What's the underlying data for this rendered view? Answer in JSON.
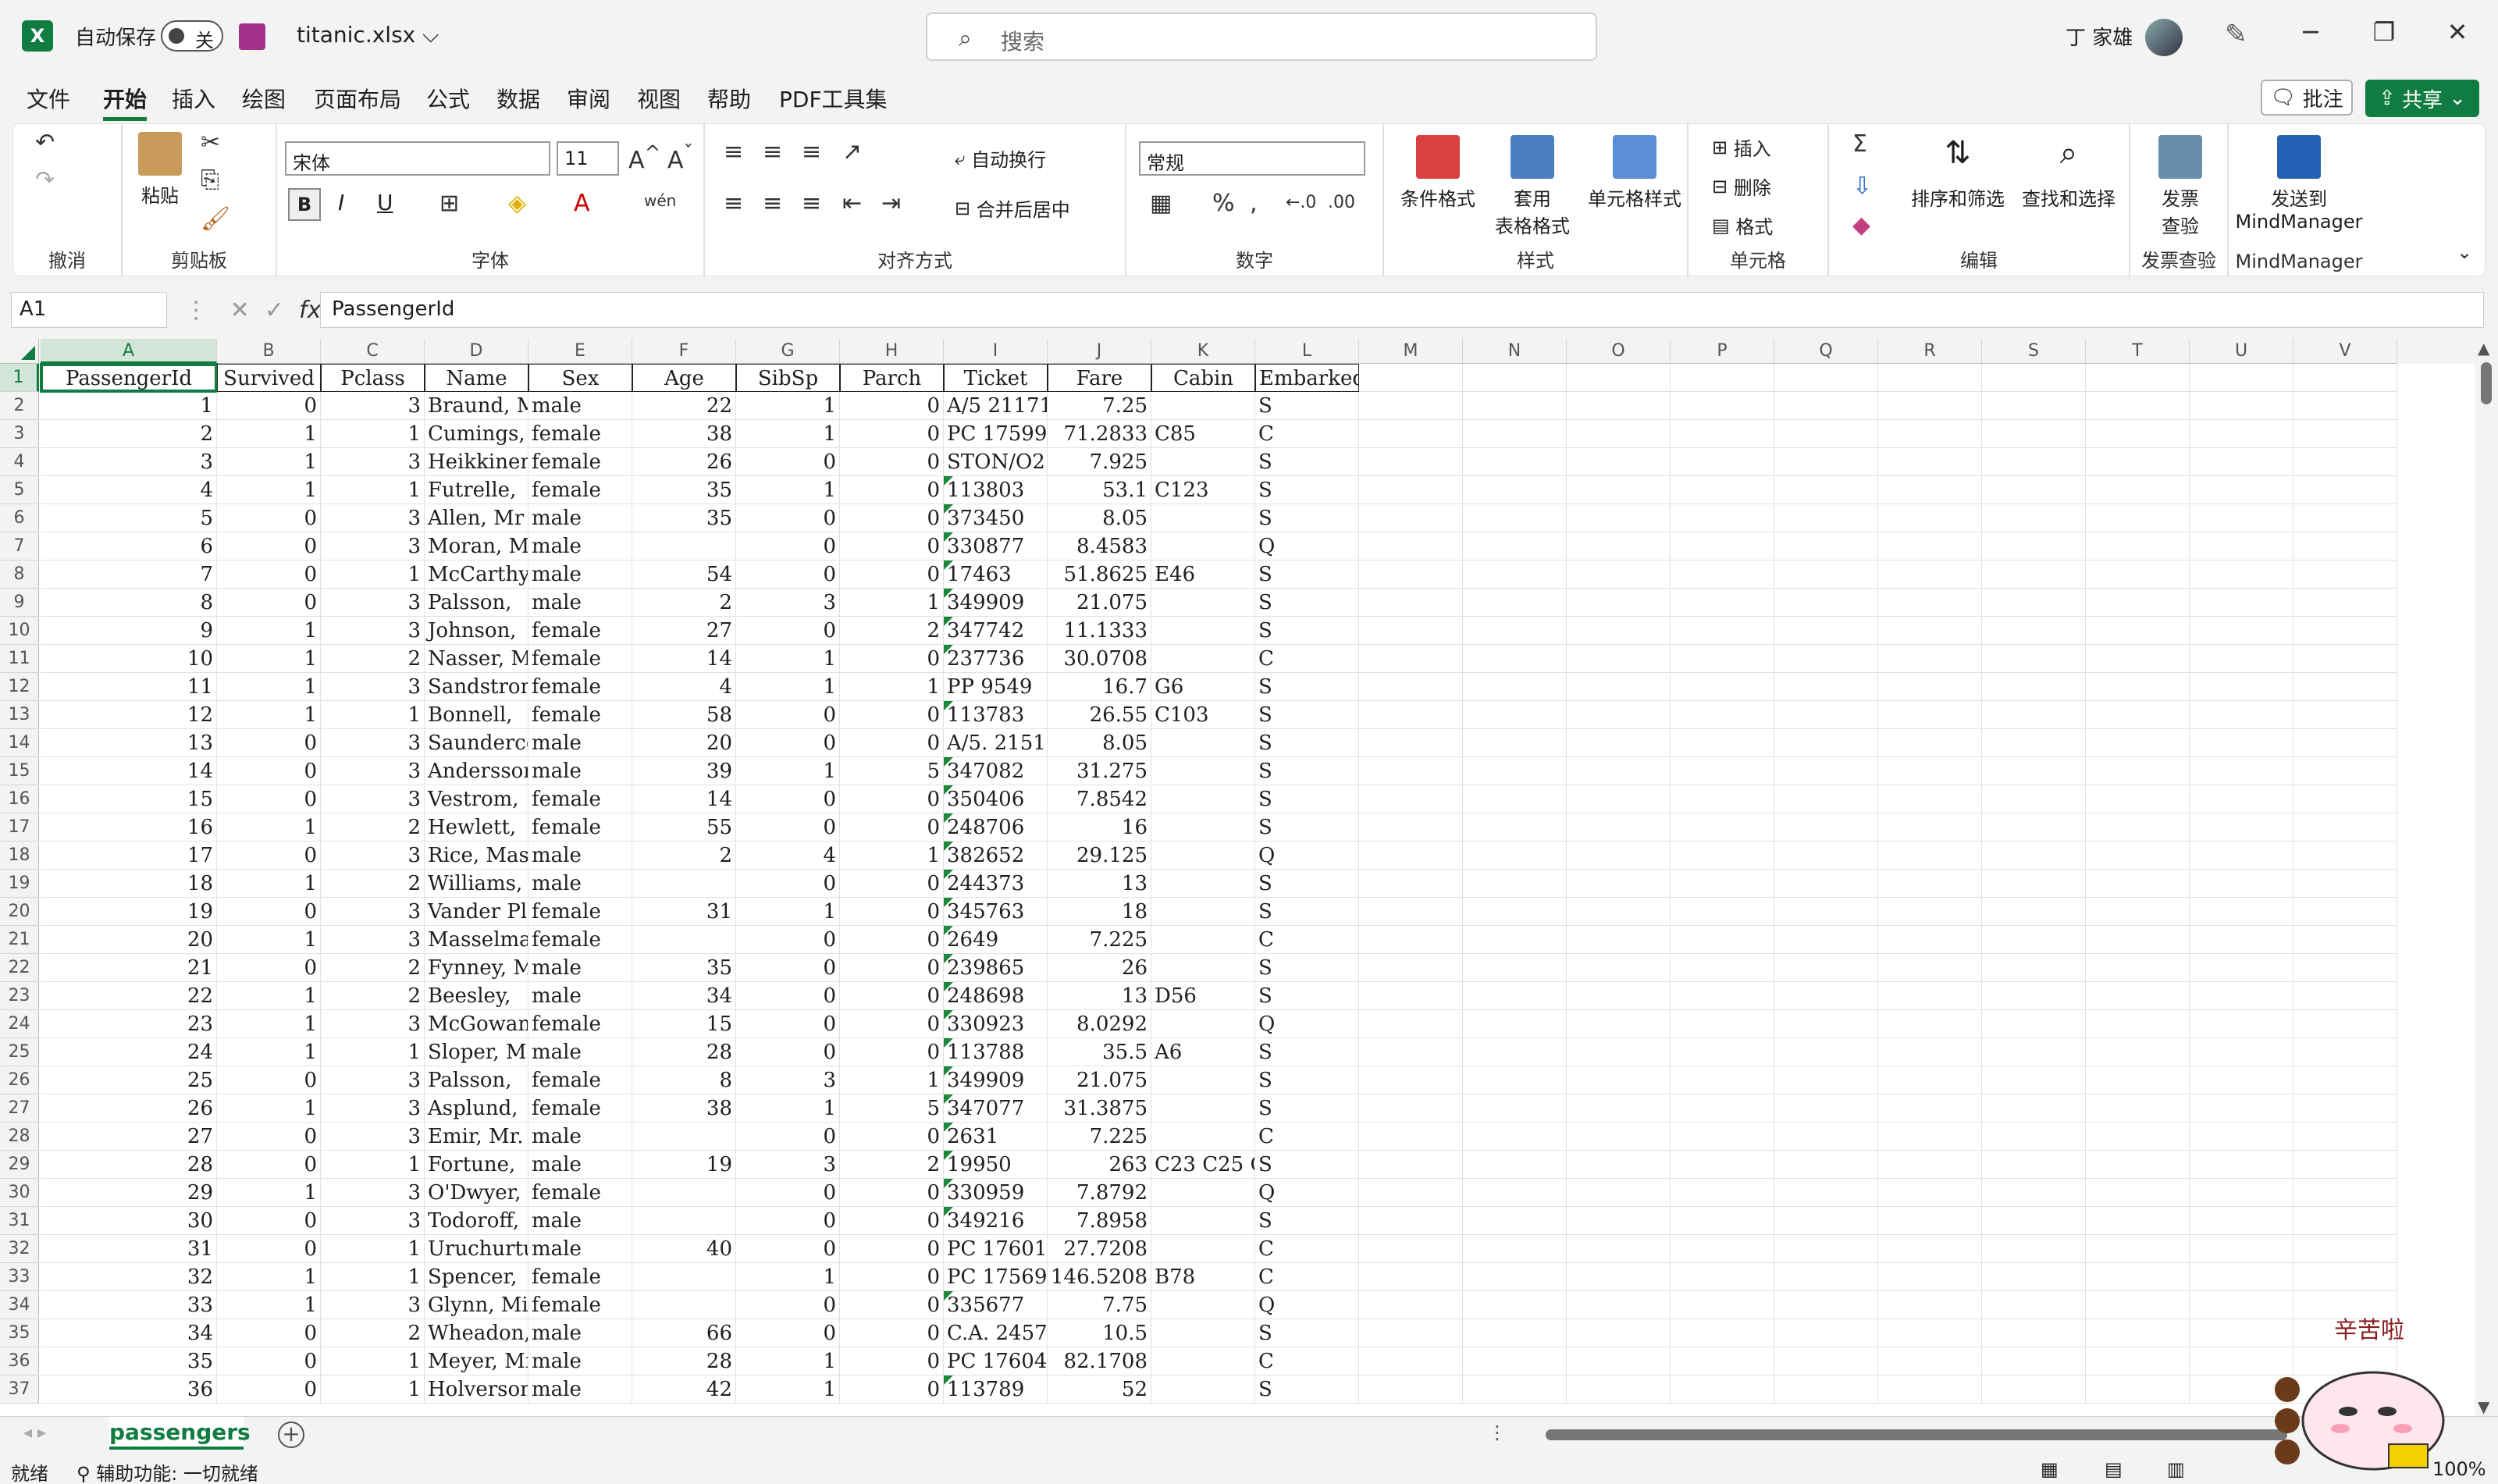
{
  "titlebar": {
    "autosave_label": "自动保存",
    "autosave_state": "关",
    "file_name": "titanic.xlsx ⌵",
    "search_placeholder": "搜索",
    "user_name": "丁 家雄",
    "minimize": "─",
    "restore": "❐",
    "close": "✕"
  },
  "menu": {
    "tabs": [
      "文件",
      "开始",
      "插入",
      "绘图",
      "页面布局",
      "公式",
      "数据",
      "审阅",
      "视图",
      "帮助",
      "PDF工具集"
    ],
    "active": "开始",
    "comment_label": "批注",
    "share_label": "共享"
  },
  "ribbon": {
    "undo_group": "撤消",
    "clipboard_group": "剪贴板",
    "paste_label": "粘贴",
    "font_group": "字体",
    "font_name": "宋体",
    "font_size": "11",
    "bold": "B",
    "italic": "I",
    "underline": "U",
    "align_group": "对齐方式",
    "wrap_label": "自动换行",
    "merge_label": "合并后居中",
    "number_group": "数字",
    "number_format": "常规",
    "styles_group": "样式",
    "cond_format": "条件格式",
    "table_format": "套用\n表格格式",
    "cell_styles": "单元格样式",
    "cells_group": "单元格",
    "insert_label": "插入",
    "delete_label": "删除",
    "format_label": "格式",
    "edit_group": "编辑",
    "sort_filter": "排序和筛选",
    "find_select": "查找和选择",
    "invoice_group": "发票查验",
    "invoice_label": "发票\n查验",
    "mindmanager_group": "MindManager",
    "mindmanager_label": "发送到\nMindManager"
  },
  "formula_bar": {
    "name_box": "A1",
    "formula": "PassengerId"
  },
  "columns": [
    "A",
    "B",
    "C",
    "D",
    "E",
    "F",
    "G",
    "H",
    "I",
    "J",
    "K",
    "L",
    "M",
    "N",
    "O",
    "P",
    "Q",
    "R",
    "S",
    "T",
    "U",
    "V"
  ],
  "header_row": [
    "PassengerId",
    "Survived",
    "Pclass",
    "Name",
    "Sex",
    "Age",
    "SibSp",
    "Parch",
    "Ticket",
    "Fare",
    "Cabin",
    "Embarked"
  ],
  "rows": [
    [
      "1",
      "0",
      "3",
      "Braund, M",
      "male",
      "22",
      "1",
      "0",
      "A/5 21171",
      "7.25",
      "",
      "S"
    ],
    [
      "2",
      "1",
      "1",
      "Cumings,",
      "female",
      "38",
      "1",
      "0",
      "PC 17599",
      "71.2833",
      "C85",
      "C"
    ],
    [
      "3",
      "1",
      "3",
      "Heikkinen",
      "female",
      "26",
      "0",
      "0",
      "STON/O2.",
      "7.925",
      "",
      "S"
    ],
    [
      "4",
      "1",
      "1",
      "Futrelle,",
      "female",
      "35",
      "1",
      "0",
      "113803",
      "53.1",
      "C123",
      "S"
    ],
    [
      "5",
      "0",
      "3",
      "Allen, Mr",
      "male",
      "35",
      "0",
      "0",
      "373450",
      "8.05",
      "",
      "S"
    ],
    [
      "6",
      "0",
      "3",
      "Moran, Mr",
      "male",
      "",
      "0",
      "0",
      "330877",
      "8.4583",
      "",
      "Q"
    ],
    [
      "7",
      "0",
      "1",
      "McCarthy,",
      "male",
      "54",
      "0",
      "0",
      "17463",
      "51.8625",
      "E46",
      "S"
    ],
    [
      "8",
      "0",
      "3",
      "Palsson,",
      "male",
      "2",
      "3",
      "1",
      "349909",
      "21.075",
      "",
      "S"
    ],
    [
      "9",
      "1",
      "3",
      "Johnson,",
      "female",
      "27",
      "0",
      "2",
      "347742",
      "11.1333",
      "",
      "S"
    ],
    [
      "10",
      "1",
      "2",
      "Nasser, M",
      "female",
      "14",
      "1",
      "0",
      "237736",
      "30.0708",
      "",
      "C"
    ],
    [
      "11",
      "1",
      "3",
      "Sandstrom",
      "female",
      "4",
      "1",
      "1",
      "PP 9549",
      "16.7",
      "G6",
      "S"
    ],
    [
      "12",
      "1",
      "1",
      "Bonnell,",
      "female",
      "58",
      "0",
      "0",
      "113783",
      "26.55",
      "C103",
      "S"
    ],
    [
      "13",
      "0",
      "3",
      "Saunderco",
      "male",
      "20",
      "0",
      "0",
      "A/5. 2151",
      "8.05",
      "",
      "S"
    ],
    [
      "14",
      "0",
      "3",
      "Andersson",
      "male",
      "39",
      "1",
      "5",
      "347082",
      "31.275",
      "",
      "S"
    ],
    [
      "15",
      "0",
      "3",
      "Vestrom,",
      "female",
      "14",
      "0",
      "0",
      "350406",
      "7.8542",
      "",
      "S"
    ],
    [
      "16",
      "1",
      "2",
      "Hewlett,",
      "female",
      "55",
      "0",
      "0",
      "248706",
      "16",
      "",
      "S"
    ],
    [
      "17",
      "0",
      "3",
      "Rice, Mas",
      "male",
      "2",
      "4",
      "1",
      "382652",
      "29.125",
      "",
      "Q"
    ],
    [
      "18",
      "1",
      "2",
      "Williams,",
      "male",
      "",
      "0",
      "0",
      "244373",
      "13",
      "",
      "S"
    ],
    [
      "19",
      "0",
      "3",
      "Vander Pl",
      "female",
      "31",
      "1",
      "0",
      "345763",
      "18",
      "",
      "S"
    ],
    [
      "20",
      "1",
      "3",
      "Masselmar",
      "female",
      "",
      "0",
      "0",
      "2649",
      "7.225",
      "",
      "C"
    ],
    [
      "21",
      "0",
      "2",
      "Fynney, M",
      "male",
      "35",
      "0",
      "0",
      "239865",
      "26",
      "",
      "S"
    ],
    [
      "22",
      "1",
      "2",
      "Beesley,",
      "male",
      "34",
      "0",
      "0",
      "248698",
      "13",
      "D56",
      "S"
    ],
    [
      "23",
      "1",
      "3",
      "McGowan,",
      "female",
      "15",
      "0",
      "0",
      "330923",
      "8.0292",
      "",
      "Q"
    ],
    [
      "24",
      "1",
      "1",
      "Sloper, M",
      "male",
      "28",
      "0",
      "0",
      "113788",
      "35.5",
      "A6",
      "S"
    ],
    [
      "25",
      "0",
      "3",
      "Palsson,",
      "female",
      "8",
      "3",
      "1",
      "349909",
      "21.075",
      "",
      "S"
    ],
    [
      "26",
      "1",
      "3",
      "Asplund,",
      "female",
      "38",
      "1",
      "5",
      "347077",
      "31.3875",
      "",
      "S"
    ],
    [
      "27",
      "0",
      "3",
      "Emir, Mr.",
      "male",
      "",
      "0",
      "0",
      "2631",
      "7.225",
      "",
      "C"
    ],
    [
      "28",
      "0",
      "1",
      "Fortune,",
      "male",
      "19",
      "3",
      "2",
      "19950",
      "263",
      "C23 C25 C",
      "S"
    ],
    [
      "29",
      "1",
      "3",
      "O'Dwyer,",
      "female",
      "",
      "0",
      "0",
      "330959",
      "7.8792",
      "",
      "Q"
    ],
    [
      "30",
      "0",
      "3",
      "Todoroff,",
      "male",
      "",
      "0",
      "0",
      "349216",
      "7.8958",
      "",
      "S"
    ],
    [
      "31",
      "0",
      "1",
      "Uruchurtu",
      "male",
      "40",
      "0",
      "0",
      "PC 17601",
      "27.7208",
      "",
      "C"
    ],
    [
      "32",
      "1",
      "1",
      "Spencer,",
      "female",
      "",
      "1",
      "0",
      "PC 17569",
      "146.5208",
      "B78",
      "C"
    ],
    [
      "33",
      "1",
      "3",
      "Glynn, Mi",
      "female",
      "",
      "0",
      "0",
      "335677",
      "7.75",
      "",
      "Q"
    ],
    [
      "34",
      "0",
      "2",
      "Wheadon,",
      "male",
      "66",
      "0",
      "0",
      "C.A. 2457",
      "10.5",
      "",
      "S"
    ],
    [
      "35",
      "0",
      "1",
      "Meyer, Mr",
      "male",
      "28",
      "1",
      "0",
      "PC 17604",
      "82.1708",
      "",
      "C"
    ],
    [
      "36",
      "0",
      "1",
      "Holverson",
      "male",
      "42",
      "1",
      "0",
      "113789",
      "52",
      "",
      "S"
    ]
  ],
  "sheet": {
    "tab_name": "passengers",
    "add_sheet": "+"
  },
  "status": {
    "ready": "就绪",
    "accessibility": "辅助功能: 一切就绪",
    "zoom": "100%"
  },
  "sticker_text": "辛苦啦"
}
